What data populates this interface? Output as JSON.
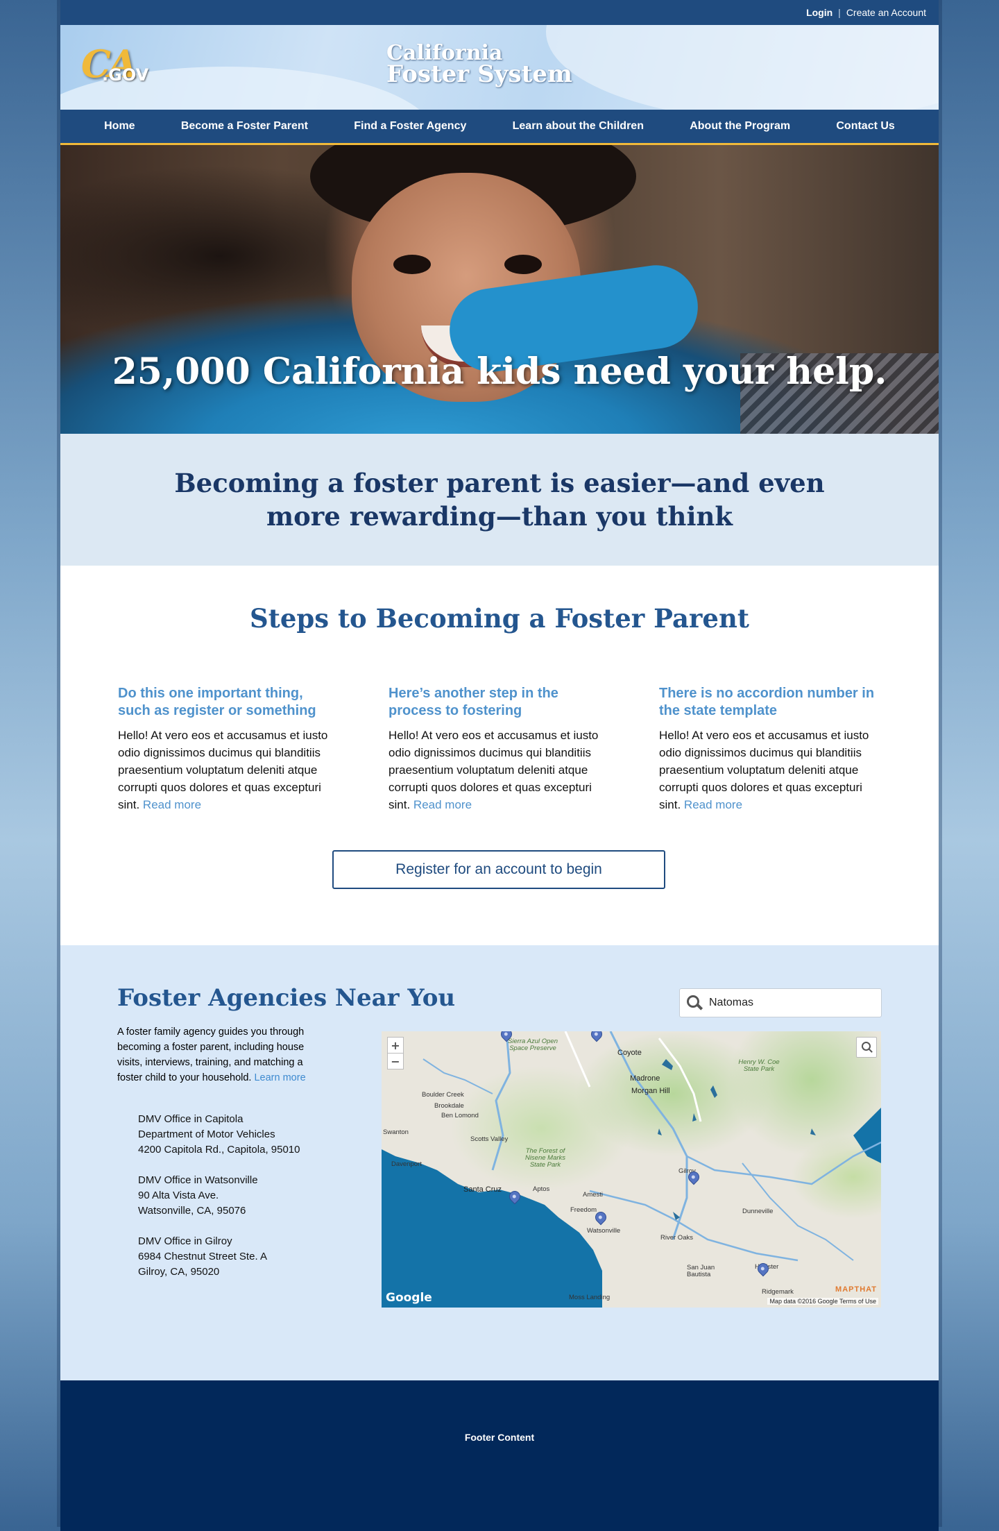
{
  "utility": {
    "login": "Login",
    "separator": "|",
    "create_account": "Create an Account"
  },
  "header": {
    "logo_ca": "CA",
    "logo_gov": ".GOV",
    "title_line1": "California",
    "title_line2": "Foster System"
  },
  "nav": {
    "items": [
      "Home",
      "Become a Foster Parent",
      "Find a Foster Agency",
      "Learn about the Children",
      "About the Program",
      "Contact Us"
    ]
  },
  "hero": {
    "headline": "25,000 California kids need your help."
  },
  "tagline": {
    "text": "Becoming a foster parent is easier—and even more rewarding—than you think"
  },
  "steps": {
    "title": "Steps to Becoming a Foster Parent",
    "items": [
      {
        "heading": "Do this one important thing, such as register or something",
        "body": "Hello! At vero eos et accusamus et iusto odio dignissimos ducimus qui blanditiis praesentium voluptatum deleniti atque corrupti quos dolores et quas excepturi sint.",
        "link": "Read more"
      },
      {
        "heading": "Here’s another step in the process to fostering",
        "body": "Hello! At vero eos et accusamus et iusto odio dignissimos ducimus qui blanditiis praesentium voluptatum deleniti atque corrupti quos dolores et quas excepturi sint.",
        "link": "Read more"
      },
      {
        "heading": "There is no accordion number in the state template",
        "body": "Hello! At vero eos et accusamus et iusto odio dignissimos ducimus qui blanditiis praesentium voluptatum deleniti atque corrupti quos dolores et quas excepturi sint.",
        "link": "Read more"
      }
    ],
    "cta": "Register for an account to begin"
  },
  "agencies": {
    "title": "Foster Agencies Near You",
    "search_value": "Natomas",
    "description": "A foster family agency guides you through becoming a foster parent, including house visits, interviews, training, and matching a foster child to your household.",
    "description_link": "Learn more",
    "offices": [
      {
        "name": "DMV Office in Capitola",
        "line2": "Department of Motor Vehicles",
        "line3": "4200 Capitola Rd., Capitola, 95010"
      },
      {
        "name": "DMV Office in Watsonville",
        "line2": "90 Alta Vista Ave.",
        "line3": "Watsonville, CA, 95076"
      },
      {
        "name": "DMV Office in Gilroy",
        "line2": "6984 Chestnut Street Ste. A",
        "line3": "Gilroy, CA, 95020"
      }
    ]
  },
  "map": {
    "zoom_in": "+",
    "zoom_out": "−",
    "google": "Google",
    "mapthat": "MAPTHAT",
    "attribution": "Map data ©2016 Google    Terms of Use",
    "places": {
      "coyote": "Coyote",
      "madrone": "Madrone",
      "morgan_hill": "Morgan Hill",
      "boulder_creek": "Boulder Creek",
      "brookdale": "Brookdale",
      "ben_lomond": "Ben Lomond",
      "swanton": "Swanton",
      "scotts_valley": "Scotts Valley",
      "davenport": "Davenport",
      "santa_cruz": "Santa Cruz",
      "aptos": "Aptos",
      "amesti": "Amesti",
      "freedom": "Freedom",
      "watsonville": "Watsonville",
      "gilroy": "Gilroy",
      "dunneville": "Dunneville",
      "river_oaks": "River Oaks",
      "san_juan_bautista": "San Juan Bautista",
      "hollister": "Hollister",
      "ridgemark": "Ridgemark",
      "moss_landing": "Moss Landing",
      "sierra_azul": "Sierra Azul Open Space Preserve",
      "nisene_marks": "The Forest of Nisene Marks State Park",
      "henry_coe": "Henry W. Coe State Park"
    }
  },
  "footer": {
    "text": "Footer Content"
  }
}
